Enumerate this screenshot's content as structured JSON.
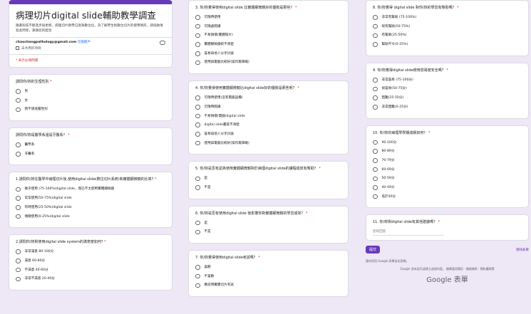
{
  "form": {
    "title": "病理切片digital slide輔助教學調查",
    "description": "隨著科技不斷進步與更新，病理切片教學已逐漸數位化，為了解學生對數位切片的使用情形，請協助填寫此問卷，謝謝您的配合",
    "account_email": "chaochangpathology@gmail.com",
    "switch_account": "切換帳戶",
    "not_saved": "未共用的項目",
    "required_note": "* 表示必填問題"
  },
  "col1": [
    {
      "question": "請問你/妳的生理性別",
      "options": [
        "男",
        "女",
        "我不想透露性別"
      ]
    },
    {
      "question": "請問你/妳是醫學系還是牙醫系？",
      "options": [
        "醫學系",
        "牙醫系"
      ]
    },
    {
      "question": "1.請問你/妳在醫學中病理切片後,使用digital slide(數位切片系統)和實體顯微鏡的比率?",
      "options": [
        "幾乎使用 (75-100%)digital slide，我已不太使用實體顯微鏡",
        "常常使用(50-75%)digital slide",
        "有時使用(25-50%)digital slide",
        "偶爾使用(0-25%)digital slide"
      ]
    },
    {
      "question": "2.請問你/妳對使用digital slide system的滿意度如何?",
      "options": [
        "非常滿意 80-100分",
        "滿意 60-80分",
        "不滿意 40-60分",
        "非常不滿意 20-40分"
      ]
    }
  ],
  "col2": [
    {
      "question": "3. 你/妳覺得使用digital slide 比實體顯微鏡好的優勢是那些？",
      "options": [
        "可隨時使用",
        "可隨處閱讀",
        "不易損壞(實體玻片)",
        "實體顯微鏡較不清楚",
        "容易與他人分享討論",
        "使用與電腦比較好(操作無障礙)"
      ]
    },
    {
      "question": "4. 你/妳覺得使用實體顯微鏡比digital slide好的優勢是那些呢？",
      "options": [
        "可隨時使用(沒有電腦設備)",
        "可隨時閱讀",
        "不易損壞(電腦/digital slide",
        "digital slide畫質不清楚",
        "容易與他人分享討論",
        "使用與電腦比較好(操作無障礙)"
      ]
    },
    {
      "question": "5. 你/妳是否有認為使用實體顯微鏡對於病理digital slide的課程成效有幫助？",
      "options": [
        "是",
        "不是"
      ]
    },
    {
      "question": "6. 你/妳是否有使用digital slide 後影響你對實體顯微鏡的學習成效？",
      "options": [
        "是",
        "不是"
      ]
    },
    {
      "question": "7. 你/妳覺得使用digital slide考試嗎？",
      "options": [
        "喜歡",
        "不喜歡",
        "應該用實體切片考試"
      ]
    }
  ],
  "col3": [
    {
      "question": "8. 你/妳覺得 digital slide 對你/妳的學習有幫助嗎？",
      "options": [
        "非常有幫助 (75-100%)",
        "很有幫助(50-75%)",
        "有幫助(25-50%)",
        "幫助不大(0-25%)"
      ]
    },
    {
      "question": "9. 你/妳覺得digital slide使用容易度安全嗎？",
      "options": [
        "非常容易 (75-100分)",
        "很容易(50-75分)",
        "困難(25-50分)",
        "非常困難(0-25分)"
      ]
    },
    {
      "question": "10. 你/妳的病理學學期成績如何？",
      "options": [
        "90-100分",
        "80-89分",
        "70-79分",
        "60-69分",
        "50-59分",
        "40-49分",
        "低於40分"
      ]
    },
    {
      "question": "11. 你/妳對digital slide有其他建議嗎？",
      "options": [],
      "answer_placeholder": "您的回答"
    }
  ],
  "footer": {
    "submit": "提交",
    "clear": "清除表單",
    "never_submit": "請勿利用 Google 表單送出密碼。",
    "disclaimer": "Google 並未認可或建立這項內容。 檢舉濫用情形 · 服務條款 · 隱私權政策",
    "brand": "Google 表單"
  },
  "colors": {
    "accent": "#673ab7",
    "background": "#ede7f6",
    "required": "#d93025"
  }
}
